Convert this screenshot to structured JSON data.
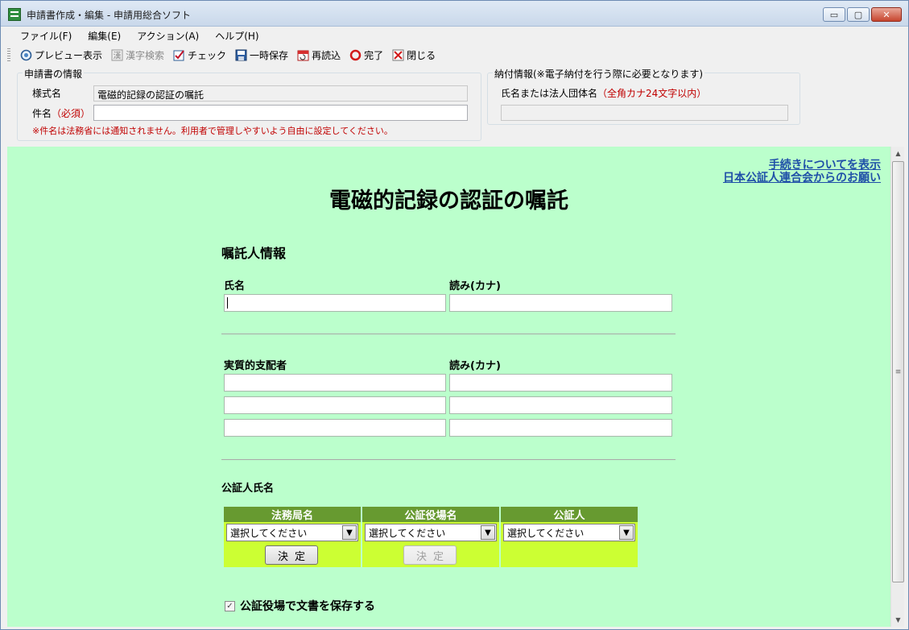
{
  "window": {
    "title": "申請書作成・編集 - 申請用総合ソフト",
    "buttons": {
      "minimize": "▭",
      "maximize": "▢",
      "close": "✕"
    }
  },
  "menu": [
    "ファイル(F)",
    "編集(E)",
    "アクション(A)",
    "ヘルプ(H)"
  ],
  "toolbar": [
    {
      "label": "プレビュー表示",
      "icon": "preview-icon",
      "disabled": false
    },
    {
      "label": "漢字検索",
      "icon": "kanji-search-icon",
      "disabled": true
    },
    {
      "label": "チェック",
      "icon": "check-icon",
      "disabled": false
    },
    {
      "label": "一時保存",
      "icon": "save-icon",
      "disabled": false
    },
    {
      "label": "再読込",
      "icon": "reload-icon",
      "disabled": false
    },
    {
      "label": "完了",
      "icon": "complete-icon",
      "disabled": false
    },
    {
      "label": "閉じる",
      "icon": "close-icon",
      "disabled": false
    }
  ],
  "app_info": {
    "legend": "申請書の情報",
    "form_name_label": "様式名",
    "form_name_value": "電磁的記録の認証の嘱託",
    "subject_label": "件名",
    "subject_required": "（必須）",
    "subject_value": "",
    "note": "※件名は法務省には通知されません。利用者で管理しやすいよう自由に設定してください。"
  },
  "payment_info": {
    "legend": "納付情報(※電子納付を行う際に必要となります)",
    "name_label": "氏名または法人団体名",
    "name_hint": "（全角カナ24文字以内）",
    "name_value": ""
  },
  "content": {
    "links": [
      "手続きについてを表示",
      "日本公証人連合会からのお願い"
    ],
    "title": "電磁的記録の認証の嘱託",
    "section_applicant": "嘱託人情報",
    "name_label": "氏名",
    "kana_label": "読み(カナ)",
    "beneficial_owner_label": "実質的支配者",
    "beneficial_kana_label": "読み(カナ)",
    "notary_section": "公証人氏名",
    "table_headers": [
      "法務局名",
      "公証役場名",
      "公証人"
    ],
    "select_placeholder": "選択してください",
    "decide_label": "決定",
    "save_checkbox_label": "公証役場で文書を保存する",
    "save_checked": true
  },
  "colors": {
    "content_bg": "#bbffcc",
    "table_header": "#679a30",
    "table_cell": "#ccff33",
    "link": "#1f4fa8",
    "required": "#c00000"
  }
}
